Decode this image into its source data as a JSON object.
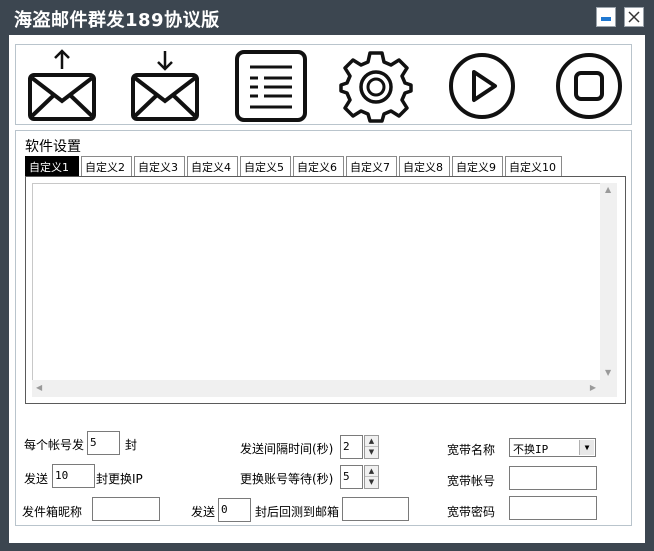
{
  "window": {
    "title": "海盗邮件群发189协议版"
  },
  "toolbar": {
    "icons": [
      "mail-upload-icon",
      "mail-download-icon",
      "list-icon",
      "gear-icon",
      "play-icon",
      "stop-icon"
    ]
  },
  "settings": {
    "group_label": "软件设置",
    "tabs": [
      "自定义1",
      "自定义2",
      "自定义3",
      "自定义4",
      "自定义5",
      "自定义6",
      "自定义7",
      "自定义8",
      "自定义9",
      "自定义10"
    ],
    "active_tab": 0,
    "textarea_value": ""
  },
  "form": {
    "per_account_label": "每个帐号发",
    "per_account_value": "5",
    "per_account_unit": "封",
    "send_label": "发送",
    "send_value": "10",
    "send_suffix": "封更换IP",
    "sender_nick_label": "发件箱昵称",
    "sender_nick_value": "",
    "interval_label": "发送间隔时间(秒)",
    "interval_value": "2",
    "switch_wait_label": "更换账号等待(秒)",
    "switch_wait_value": "5",
    "send2_label": "发送",
    "send2_value": "0",
    "send2_suffix": "封后回测到邮箱",
    "test_mailbox_value": "",
    "broadband_name_label": "宽带名称",
    "broadband_name_value": "不换IP",
    "broadband_account_label": "宽带帐号",
    "broadband_account_value": "",
    "broadband_password_label": "宽带密码",
    "broadband_password_value": ""
  },
  "colors": {
    "frame": "#3c4650",
    "accent": "#1f78d1"
  }
}
